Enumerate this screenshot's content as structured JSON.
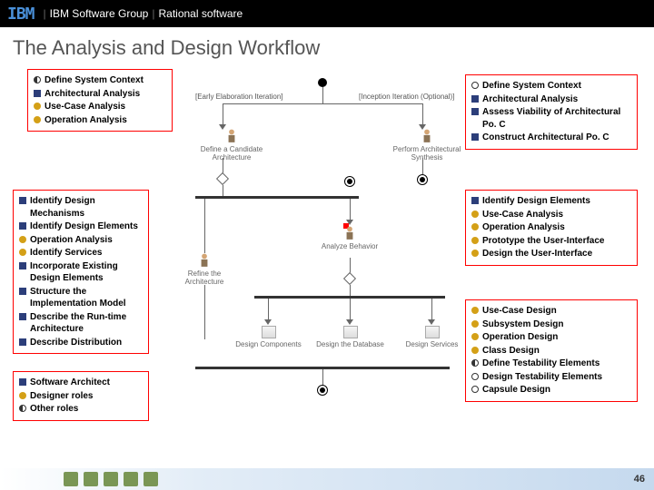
{
  "header": {
    "logo": "IBM",
    "group": "IBM Software Group",
    "product": "Rational software"
  },
  "title": "The Analysis and Design Workflow",
  "boxes": {
    "topLeft": [
      {
        "b": "half",
        "t": "Define System Context"
      },
      {
        "b": "arch",
        "t": "Architectural Analysis"
      },
      {
        "b": "des",
        "t": "Use-Case Analysis"
      },
      {
        "b": "des",
        "t": "Operation Analysis"
      }
    ],
    "topRight": [
      {
        "b": "open",
        "t": "Define System Context"
      },
      {
        "b": "arch",
        "t": "Architectural Analysis"
      },
      {
        "b": "arch",
        "t": "Assess Viability of Architectural Po. C"
      },
      {
        "b": "arch",
        "t": "Construct Architectural Po. C"
      }
    ],
    "midLeft": [
      {
        "b": "arch",
        "t": "Identify Design Mechanisms"
      },
      {
        "b": "arch",
        "t": "Identify Design Elements"
      },
      {
        "b": "des",
        "t": "Operation Analysis"
      },
      {
        "b": "des",
        "t": "Identify Services"
      },
      {
        "b": "arch",
        "t": "Incorporate Existing Design Elements"
      },
      {
        "b": "arch",
        "t": "Structure the Implementation Model"
      },
      {
        "b": "arch",
        "t": "Describe the Run-time Architecture"
      },
      {
        "b": "arch",
        "t": "Describe Distribution"
      }
    ],
    "midRight": [
      {
        "b": "arch",
        "t": "Identify Design Elements"
      },
      {
        "b": "des",
        "t": "Use-Case Analysis"
      },
      {
        "b": "des",
        "t": "Operation Analysis"
      },
      {
        "b": "des",
        "t": "Prototype the User-Interface"
      },
      {
        "b": "des",
        "t": "Design the User-Interface"
      }
    ],
    "lowRight": [
      {
        "b": "des",
        "t": "Use-Case Design"
      },
      {
        "b": "des",
        "t": "Subsystem Design"
      },
      {
        "b": "des",
        "t": "Operation Design"
      },
      {
        "b": "des",
        "t": "Class Design"
      },
      {
        "b": "half",
        "t": "Define Testability Elements"
      },
      {
        "b": "open",
        "t": "Design Testability Elements"
      },
      {
        "b": "open",
        "t": "Capsule Design"
      }
    ],
    "botLeft": [
      {
        "b": "arch",
        "t": "Software Architect"
      },
      {
        "b": "des",
        "t": "Designer roles"
      },
      {
        "b": "half",
        "t": "Other roles"
      }
    ]
  },
  "diagram": {
    "earlyLabel": "[Early Elaboration Iteration]",
    "inceptionLabel": "[Inception Iteration (Optional)]",
    "defCandidate": "Define a Candidate Architecture",
    "perfSynth": "Perform Architectural Synthesis",
    "refineArch": "Refine the Architecture",
    "analyzeBehavior": "Analyze Behavior",
    "designComp": "Design Components",
    "designDb": "Design the Database",
    "designServ": "Design Services"
  },
  "pageNumber": "46"
}
